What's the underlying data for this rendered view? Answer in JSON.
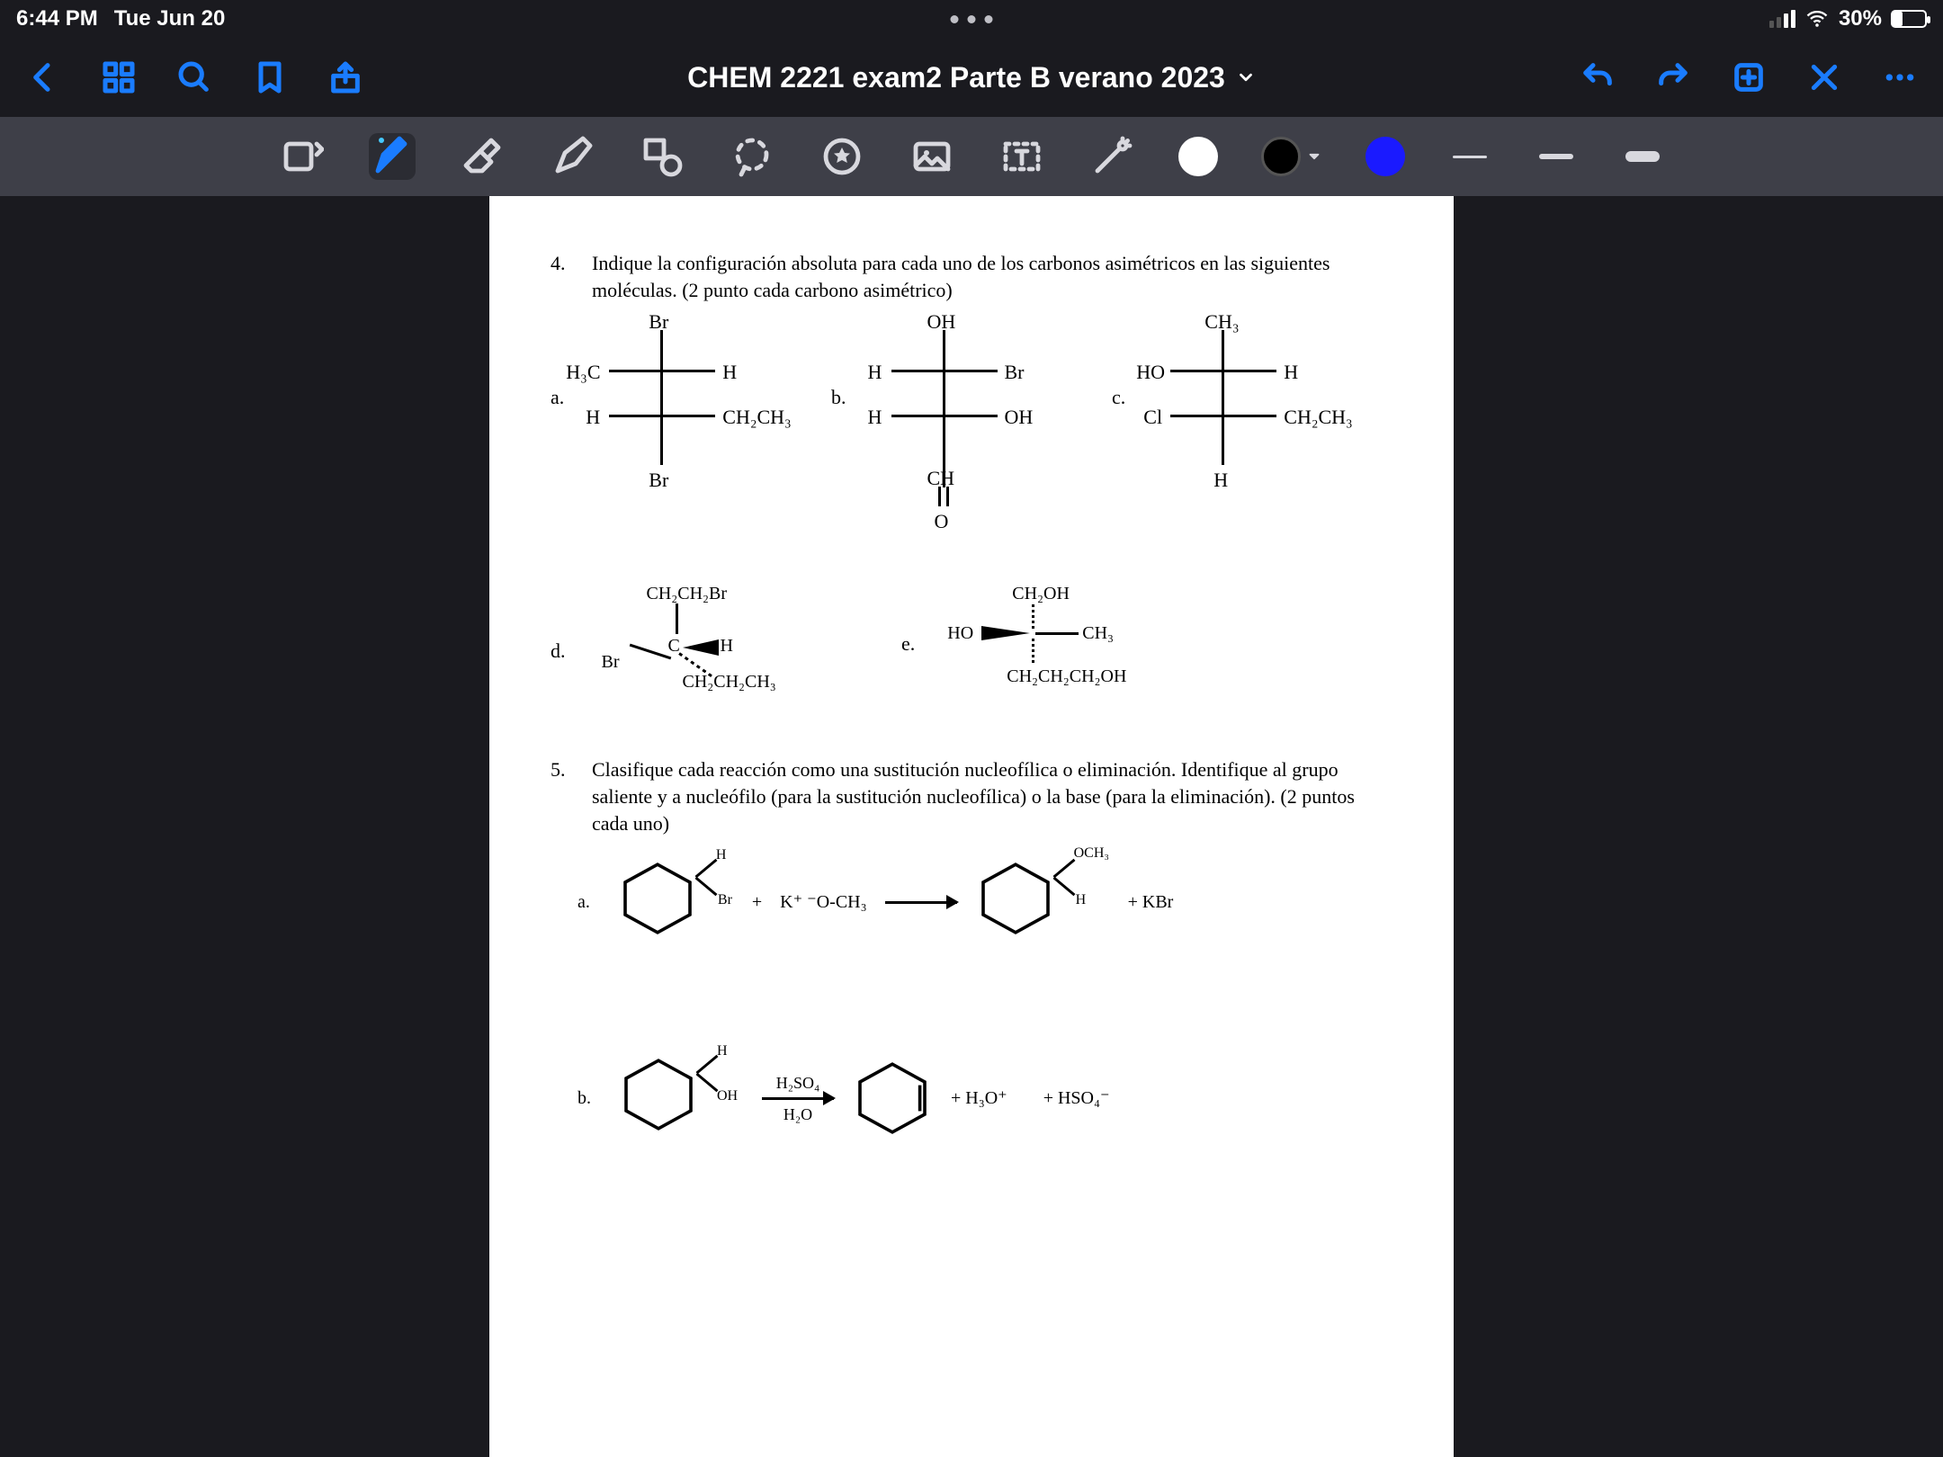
{
  "statusbar": {
    "time": "6:44 PM",
    "date": "Tue Jun 20",
    "battery_text": "30%"
  },
  "appbar": {
    "title": "CHEM 2221 exam2 Parte B verano 2023"
  },
  "colors": {
    "accent": "#1a7cff",
    "ink_blue": "#1a1aff"
  },
  "document": {
    "q4": {
      "number": "4.",
      "prompt": "Indique la configuración absoluta para cada uno de los carbonos asimétricos en las siguientes moléculas. (2 punto cada carbono asimétrico)",
      "a": {
        "label": "a.",
        "top": "Br",
        "r1l": "H₃C",
        "r1r": "H",
        "r2l": "H",
        "r2r": "CH₂CH₃",
        "bottom": "Br"
      },
      "b": {
        "label": "b.",
        "top": "OH",
        "r1l": "H",
        "r1r": "Br",
        "r2l": "H",
        "r2r": "OH",
        "bottom1": "CH",
        "bottom2": "O"
      },
      "c": {
        "label": "c.",
        "top": "CH₃",
        "r1l": "HO",
        "r1r": "H",
        "r2l": "Cl",
        "r2r": "CH₂CH₃",
        "bottom": "H"
      },
      "d": {
        "label": "d.",
        "up": "CH₂CH₂Br",
        "left": "Br",
        "wedge": "H",
        "down": "CH₂CH₂CH₃"
      },
      "e": {
        "label": "e.",
        "up": "CH₂OH",
        "left": "HO",
        "right": "CH₃",
        "down": "CH₂CH₂CH₂OH"
      }
    },
    "q5": {
      "number": "5.",
      "prompt": "Clasifique cada reacción como una sustitución nucleofílica o eliminación. Identifique al grupo saliente y a nucleófilo (para la sustitución nucleofílica) o la base (para la eliminación). (2 puntos cada uno)",
      "a": {
        "label": "a.",
        "sub_top": "H",
        "sub_bot": "Br",
        "plus": "+",
        "reagent": "K⁺ ⁻O-CH₃",
        "prod_top": "OCH₃",
        "prod_bot": "H",
        "plus2": "+  KBr"
      },
      "b": {
        "label": "b.",
        "sub_top": "H",
        "sub_bot": "OH",
        "over": "H₂SO₄",
        "under": "H₂O",
        "prod1": "+  H₃O⁺",
        "prod2": "+   HSO₄⁻"
      }
    }
  }
}
